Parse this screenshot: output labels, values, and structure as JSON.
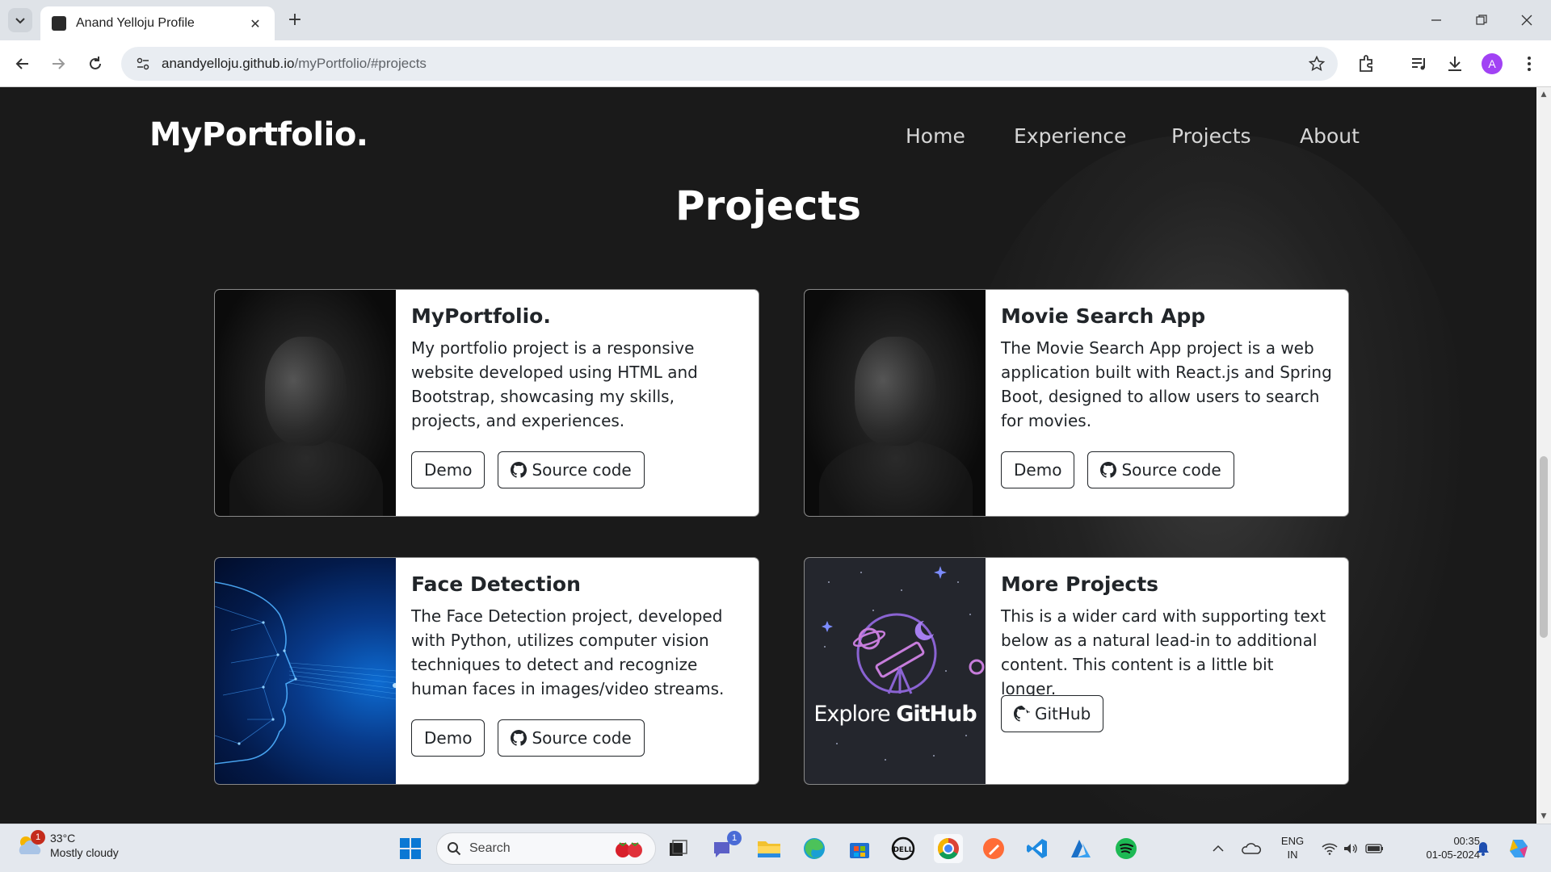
{
  "browser": {
    "tab_title": "Anand Yelloju Profile",
    "new_tab_label": "+",
    "url_host": "anandyelloju.github.io",
    "url_path": "/myPortfolio/#projects",
    "profile_initial": "A"
  },
  "site": {
    "brand": "MyPortfolio.",
    "nav": [
      "Home",
      "Experience",
      "Projects",
      "About"
    ],
    "section_title": "Projects"
  },
  "projects": [
    {
      "title": "MyPortfolio.",
      "text": "My portfolio project is a responsive website developed using HTML and Bootstrap, showcasing my skills, projects, and experiences.",
      "buttons": [
        "Demo",
        "Source code"
      ]
    },
    {
      "title": "Movie Search App",
      "text": "The Movie Search App project is a web application built with React.js and Spring Boot, designed to allow users to search for movies.",
      "buttons": [
        "Demo",
        "Source code"
      ]
    },
    {
      "title": "Face Detection",
      "text": "The Face Detection project, developed with Python, utilizes computer vision techniques to detect and recognize human faces in images/video streams.",
      "buttons": [
        "Demo",
        "Source code"
      ]
    },
    {
      "title": "More Projects",
      "text": "This is a wider card with supporting text below as a natural lead-in to additional content. This content is a little bit longer.",
      "buttons": [
        "GitHub"
      ],
      "image_text_light": "Explore ",
      "image_text_bold": "GitHub"
    }
  ],
  "taskbar": {
    "weather_temp": "33°C",
    "weather_desc": "Mostly cloudy",
    "weather_badge": "1",
    "search_placeholder": "Search",
    "chat_badge": "1",
    "lang_line1": "ENG",
    "lang_line2": "IN",
    "time": "00:35",
    "date": "01-05-2024"
  },
  "colors": {
    "page_bg": "#1a1a1a",
    "card_bg": "#ffffff",
    "text_dark": "#212529",
    "nav_text": "#d6d6d6"
  }
}
